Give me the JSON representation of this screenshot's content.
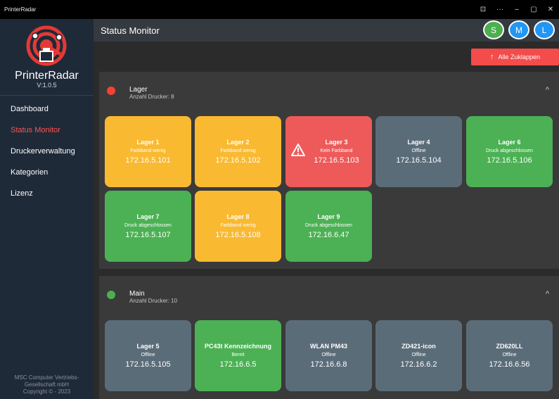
{
  "window": {
    "title": "PrinterRadar",
    "controls": [
      "⊡",
      "···",
      "–",
      "▢",
      "✕"
    ]
  },
  "sidebar": {
    "brand": "PrinterRadar",
    "version": "V:1.0.5",
    "items": [
      {
        "label": "Dashboard",
        "active": false
      },
      {
        "label": "Status Monitor",
        "active": true
      },
      {
        "label": "Druckerverwaltung",
        "active": false
      },
      {
        "label": "Kategorien",
        "active": false
      },
      {
        "label": "Lizenz",
        "active": false
      }
    ],
    "footer": [
      "MSC Computer Vertriebs-",
      "Gesellschaft mbH",
      "Copyright © - 2023"
    ]
  },
  "header": {
    "title": "Status Monitor",
    "avatars": [
      {
        "letter": "S",
        "color": "#4caf50"
      },
      {
        "letter": "M",
        "color": "#2196f3"
      },
      {
        "letter": "L",
        "color": "#2196f3"
      }
    ]
  },
  "toolbar": {
    "collapse_all": "Alle Zuklappen",
    "collapse_icon": "arrow-up-icon"
  },
  "colors": {
    "yellow": "#f9b931",
    "red": "#ee5a5a",
    "grey": "#5b6c79",
    "green": "#4bb154",
    "dot_red": "#f44336",
    "dot_green": "#4caf50"
  },
  "groups": [
    {
      "name": "Lager",
      "count": "Anzahl Drucker: 8",
      "status": "dot_red",
      "printers": [
        {
          "name": "Lager 1",
          "status": "Farbband wenig",
          "ip": "172.16.5.101",
          "color": "yellow",
          "warn": false
        },
        {
          "name": "Lager 2",
          "status": "Farbband wenig",
          "ip": "172.16.5.102",
          "color": "yellow",
          "warn": false
        },
        {
          "name": "Lager 3",
          "status": "Kein Farbband",
          "ip": "172.16.5.103",
          "color": "red",
          "warn": true
        },
        {
          "name": "Lager 4",
          "status": "Offline",
          "ip": "172.16.5.104",
          "color": "grey",
          "warn": false
        },
        {
          "name": "Lager 6",
          "status": "Druck abgeschlossen",
          "ip": "172.16.5.106",
          "color": "green",
          "warn": false
        },
        {
          "name": "Lager 7",
          "status": "Druck abgeschlossen",
          "ip": "172.16.5.107",
          "color": "green",
          "warn": false
        },
        {
          "name": "Lager 8",
          "status": "Farbband wenig",
          "ip": "172.16.5.108",
          "color": "yellow",
          "warn": false
        },
        {
          "name": "Lager 9",
          "status": "Druck abgeschlossen",
          "ip": "172.16.6.47",
          "color": "green",
          "warn": false
        }
      ]
    },
    {
      "name": "Main",
      "count": "Anzahl Drucker: 10",
      "status": "dot_green",
      "printers": [
        {
          "name": "Lager 5",
          "status": "Offline",
          "ip": "172.16.5.105",
          "color": "grey",
          "warn": false
        },
        {
          "name": "PC43t Kennzeichnung",
          "status": "Bereit",
          "ip": "172.16.6.5",
          "color": "green",
          "warn": false
        },
        {
          "name": "WLAN PM43",
          "status": "Offline",
          "ip": "172.16.6.8",
          "color": "grey",
          "warn": false
        },
        {
          "name": "ZD421-icon",
          "status": "Offline",
          "ip": "172.16.6.2",
          "color": "grey",
          "warn": false
        },
        {
          "name": "ZD620LL",
          "status": "Offline",
          "ip": "172.16.6.56",
          "color": "grey",
          "warn": false
        }
      ]
    }
  ]
}
